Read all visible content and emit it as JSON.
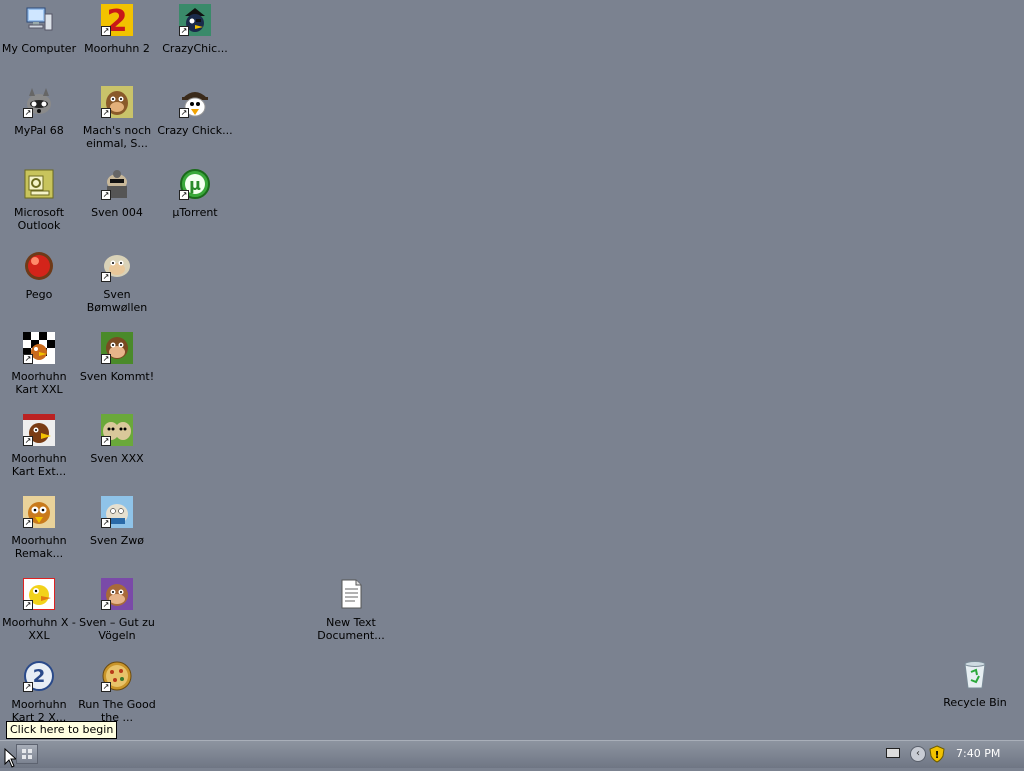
{
  "desktop": {
    "icons": [
      {
        "label": "My Computer",
        "icon": "computer-icon",
        "shortcut": false
      },
      {
        "label": "Moorhuhn 2",
        "icon": "moorhuhn-2-icon",
        "shortcut": true
      },
      {
        "label": "CrazyChic...",
        "icon": "crazy-chicken-pirate-icon",
        "shortcut": true
      },
      {
        "label": "MyPal 68",
        "icon": "raccoon-icon",
        "shortcut": true
      },
      {
        "label": "Mach's noch einmal, S...",
        "icon": "sven-sheep-icon",
        "shortcut": true
      },
      {
        "label": "Crazy Chick...",
        "icon": "crazy-chicken-icon",
        "shortcut": true
      },
      {
        "label": "Microsoft Outlook",
        "icon": "outlook-icon",
        "shortcut": false
      },
      {
        "label": "Sven 004",
        "icon": "sven-agent-icon",
        "shortcut": true
      },
      {
        "label": "μTorrent",
        "icon": "utorrent-icon",
        "shortcut": true
      },
      {
        "label": "Pego",
        "icon": "pego-ball-icon",
        "shortcut": false
      },
      {
        "label": "Sven Bømwøllen",
        "icon": "sven-sheep-icon",
        "shortcut": true
      },
      {
        "label": "Moorhuhn Kart XXL",
        "icon": "moorhuhn-kart-icon",
        "shortcut": true
      },
      {
        "label": "Sven Kommt!",
        "icon": "sven-sheep-icon",
        "shortcut": true
      },
      {
        "label": "Moorhuhn Kart Ext...",
        "icon": "moorhuhn-kart-icon",
        "shortcut": true
      },
      {
        "label": "Sven XXX",
        "icon": "sven-xxx-icon",
        "shortcut": true
      },
      {
        "label": "Moorhuhn Remak...",
        "icon": "moorhuhn-remake-icon",
        "shortcut": true
      },
      {
        "label": "Sven Zwø",
        "icon": "sven-zwo-icon",
        "shortcut": true
      },
      {
        "label": "Moorhuhn X - XXL",
        "icon": "moorhuhn-x-icon",
        "shortcut": true
      },
      {
        "label": "Sven – Gut zu Vögeln",
        "icon": "sven-sheep-icon",
        "shortcut": true
      },
      {
        "label": "Moorhuhn Kart 2 X...",
        "icon": "moorhuhn-kart-2-icon",
        "shortcut": true
      },
      {
        "label": "Run The Good the ...",
        "icon": "pizza-icon",
        "shortcut": true
      },
      {
        "label": "New Text Document...",
        "icon": "text-document-icon",
        "shortcut": false
      },
      {
        "label": "Recycle Bin",
        "icon": "recycle-bin-icon",
        "shortcut": false
      }
    ]
  },
  "tooltip": "Click here to begin",
  "taskbar": {
    "start_icon": "start-grid-icon",
    "tray_icons": [
      "keyboard-icon",
      "chevron-left-icon",
      "shield-icon"
    ],
    "clock": "7:40 PM"
  },
  "colors": {
    "desktop_background": "#7b8290",
    "taskbar": "#7a8190",
    "tooltip_background": "#ffffe1"
  }
}
